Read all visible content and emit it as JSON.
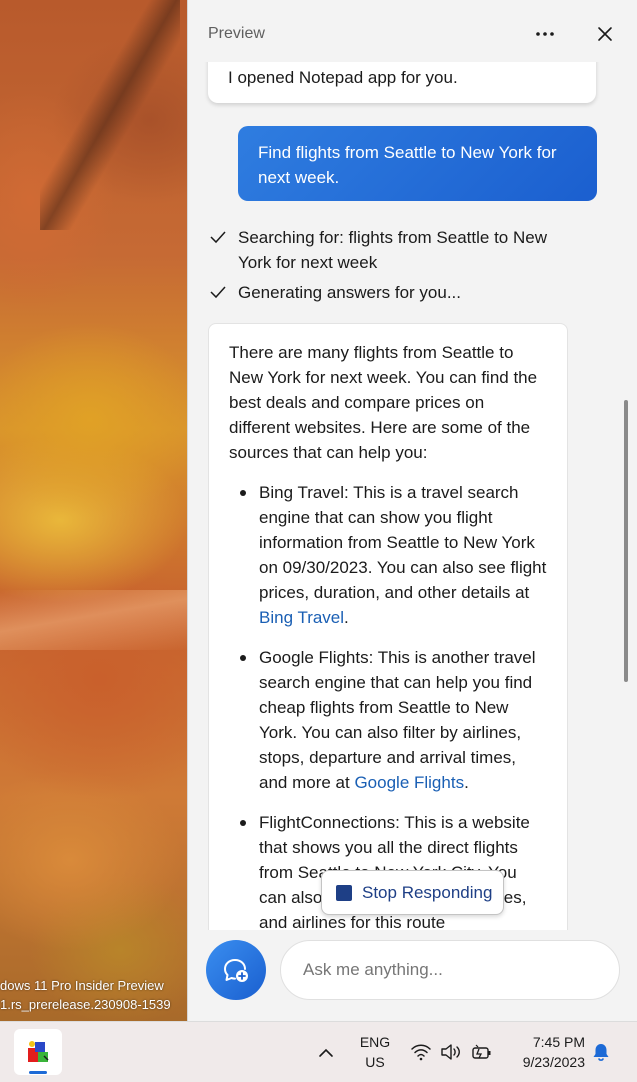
{
  "desktop": {
    "watermark_line1": "dows 11 Pro Insider Preview",
    "watermark_line2": "1.rs_prerelease.230908-1539"
  },
  "panel": {
    "title": "Preview",
    "more_icon": "more-horizontal-icon",
    "close_icon": "close-icon"
  },
  "conversation": {
    "previous_reply": "I opened Notepad app for you.",
    "user_message": "Find flights from Seattle to New York for next week.",
    "status_steps": [
      "Searching for: flights from Seattle to New York for next week",
      "Generating answers for you..."
    ],
    "answer": {
      "intro": "There are many flights from Seattle to New York for next week. You can find the best deals and compare prices on different websites. Here are some of the sources that can help you:",
      "items": [
        {
          "text": "Bing Travel: This is a travel search engine that can show you flight information from Seattle to New York on 09/30/2023. You can also see flight prices, duration, and other details at ",
          "link": "Bing Travel",
          "tail": "."
        },
        {
          "text": "Google Flights: This is another travel search engine that can help you find cheap flights from Seattle to New York. You can also filter by airlines, stops, departure and arrival times, and more at ",
          "link": "Google Flights",
          "tail": "."
        },
        {
          "text": "FlightConnections: This is a website that shows you all the direct flights from Seattle to New York City. You can also see the routes, timetables, and airlines for this route",
          "link": "",
          "tail": ""
        }
      ]
    }
  },
  "stop_button": {
    "label": "Stop Responding"
  },
  "input": {
    "placeholder": "Ask me anything..."
  },
  "taskbar": {
    "lang_line1": "ENG",
    "lang_line2": "US",
    "time": "7:45 PM",
    "date": "9/23/2023",
    "tray_icons": [
      "wifi-icon",
      "volume-icon",
      "battery-icon"
    ],
    "accent": "#1d6ad6"
  },
  "colors": {
    "user_bubble": "#2570da",
    "link": "#1a5fb4",
    "stop_text": "#1e3f86"
  }
}
